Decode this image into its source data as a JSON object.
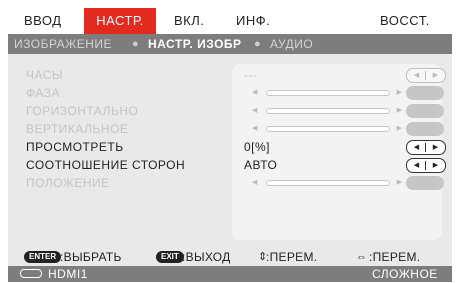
{
  "menu": {
    "tabs": [
      "ВВОД",
      "НАСТР.",
      "ВКЛ.",
      "ИНФ."
    ],
    "reset": "ВОССТ.",
    "active_color": "#e32a1f"
  },
  "submenu": {
    "tabs": [
      "ИЗОБРАЖЕНИЕ",
      "НАСТР. ИЗОБР",
      "АУДИО"
    ],
    "separator": "●"
  },
  "settings": [
    {
      "label": "ЧАСЫ",
      "value": "---",
      "control": "arrows",
      "enabled": false
    },
    {
      "label": "ФАЗА",
      "value": "",
      "control": "slider",
      "enabled": false
    },
    {
      "label": "ГОРИЗОНТАЛЬНО",
      "value": "",
      "control": "slider",
      "enabled": false
    },
    {
      "label": "ВЕРТИКАЛЬНОЕ",
      "value": "",
      "control": "slider",
      "enabled": false
    },
    {
      "label": "ПРОСМОТРЕТЬ",
      "value": "0[%]",
      "control": "arrows",
      "enabled": true
    },
    {
      "label": "СООТНОШЕНИЕ СТОРОН",
      "value": "АВТО",
      "control": "arrows",
      "enabled": true
    },
    {
      "label": "ПОЛОЖЕНИЕ",
      "value": "",
      "control": "slider",
      "enabled": false
    }
  ],
  "icons": {
    "left": "◀",
    "right": "▶",
    "updown": "⇕",
    "leftright": "⇔"
  },
  "footer": {
    "enter_key": "ENTER",
    "enter_label": ":ВЫБРАТЬ",
    "exit_key": "EXIT",
    "exit_label": ":ВЫХОД",
    "move_label": ":ПЕРЕМ.",
    "move2_label": ":ПЕРЕМ."
  },
  "status": {
    "source": "HDMI1",
    "mode": "СЛОЖНОЕ"
  }
}
